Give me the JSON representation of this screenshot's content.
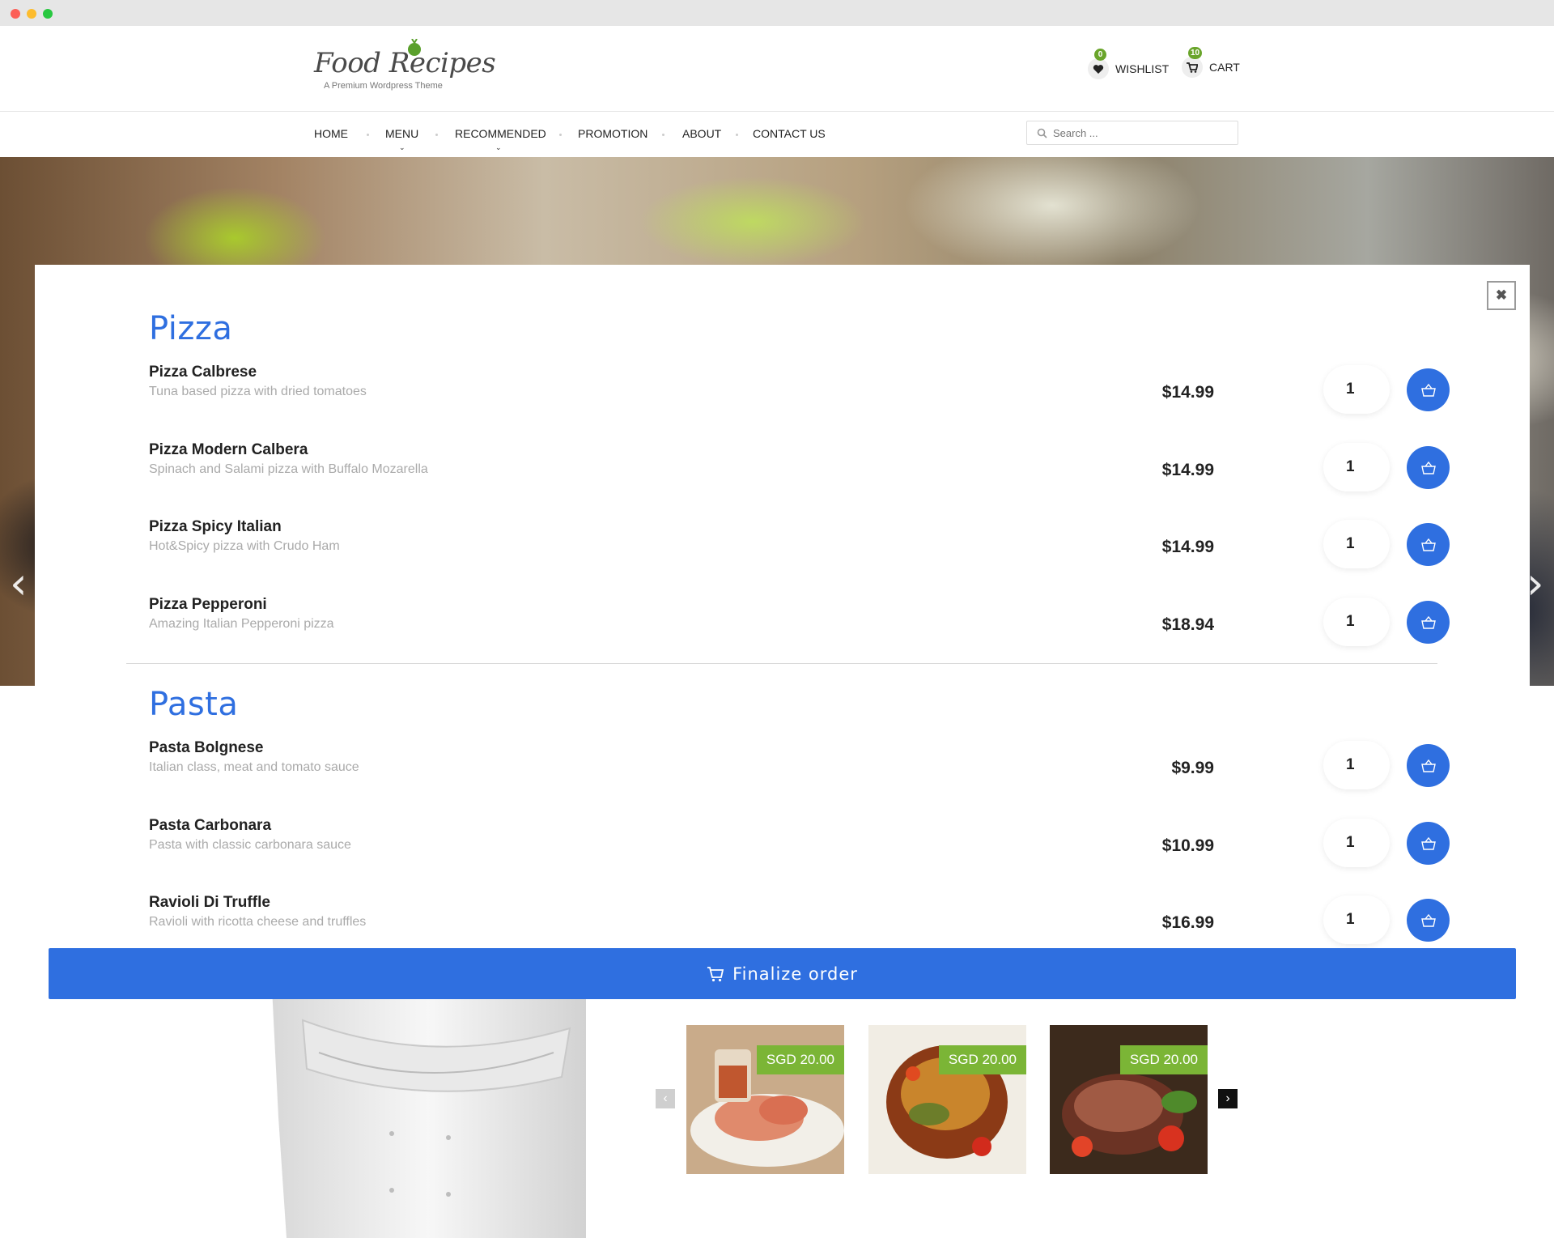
{
  "brand": {
    "title": "Food Recipes",
    "subtitle": "A Premium Wordpress Theme"
  },
  "header": {
    "wishlist": {
      "label": "WISHLIST",
      "count": "0"
    },
    "cart": {
      "label": "CART",
      "count": "10"
    }
  },
  "nav": {
    "items": [
      "HOME",
      "MENU",
      "RECOMMENDED",
      "PROMOTION",
      "ABOUT",
      "CONTACT US"
    ],
    "search_placeholder": "Search ..."
  },
  "menu": {
    "categories": [
      {
        "title": "Pizza",
        "items": [
          {
            "name": "Pizza Calbrese",
            "desc": "Tuna based pizza with dried tomatoes",
            "price": "$14.99",
            "qty": "1"
          },
          {
            "name": "Pizza Modern Calbera",
            "desc": "Spinach and Salami pizza with Buffalo Mozarella",
            "price": "$14.99",
            "qty": "1"
          },
          {
            "name": "Pizza Spicy Italian",
            "desc": "Hot&Spicy pizza with Crudo Ham",
            "price": "$14.99",
            "qty": "1"
          },
          {
            "name": "Pizza Pepperoni",
            "desc": "Amazing Italian Pepperoni pizza",
            "price": "$18.94",
            "qty": "1"
          }
        ]
      },
      {
        "title": "Pasta",
        "items": [
          {
            "name": "Pasta Bolgnese",
            "desc": "Italian class, meat and tomato sauce",
            "price": "$9.99",
            "qty": "1"
          },
          {
            "name": "Pasta Carbonara",
            "desc": "Pasta with classic carbonara sauce",
            "price": "$10.99",
            "qty": "1"
          },
          {
            "name": "Ravioli Di Truffle",
            "desc": "Ravioli with ricotta cheese and truffles",
            "price": "$16.99",
            "qty": "1"
          }
        ]
      }
    ],
    "finalize_label": "Finalize order"
  },
  "products": [
    {
      "price": "SGD 20.00"
    },
    {
      "price": "SGD 20.00"
    },
    {
      "price": "SGD 20.00"
    }
  ],
  "colors": {
    "accent": "#2f6fe0",
    "badge": "#6aa52b",
    "price_tag": "#7bb536"
  }
}
